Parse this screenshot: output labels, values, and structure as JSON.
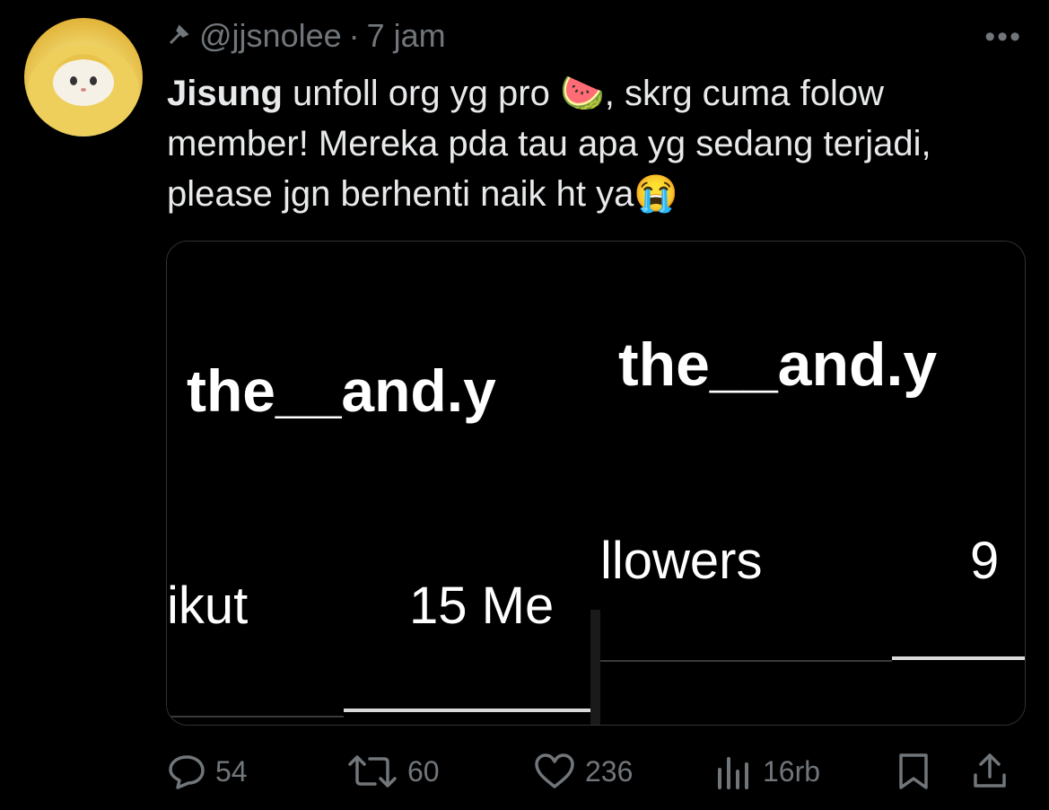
{
  "tweet": {
    "handle": "@jjsnolee",
    "separator": "·",
    "time": "7 jam",
    "more_label": "•••",
    "text": {
      "bold": "Jisung",
      "line1": " unfoll org yg pro 🍉, skrg cuma folow",
      "line2": "member! Mereka pda tau apa yg sedang terjadi,",
      "line3": "please jgn berhenti naik ht ya😭"
    }
  },
  "media": {
    "left": {
      "username": "the__and.y",
      "stat_label": "ikut",
      "stat_value": "15 Me"
    },
    "right": {
      "username": "the__and.y",
      "stat_label": "llowers",
      "stat_value": "9"
    }
  },
  "actions": {
    "replies": "54",
    "reposts": "60",
    "likes": "236",
    "views": "16rb"
  },
  "icons": [
    "pin-icon",
    "reply-icon",
    "repost-icon",
    "like-icon",
    "views-icon",
    "bookmark-icon",
    "share-icon"
  ]
}
